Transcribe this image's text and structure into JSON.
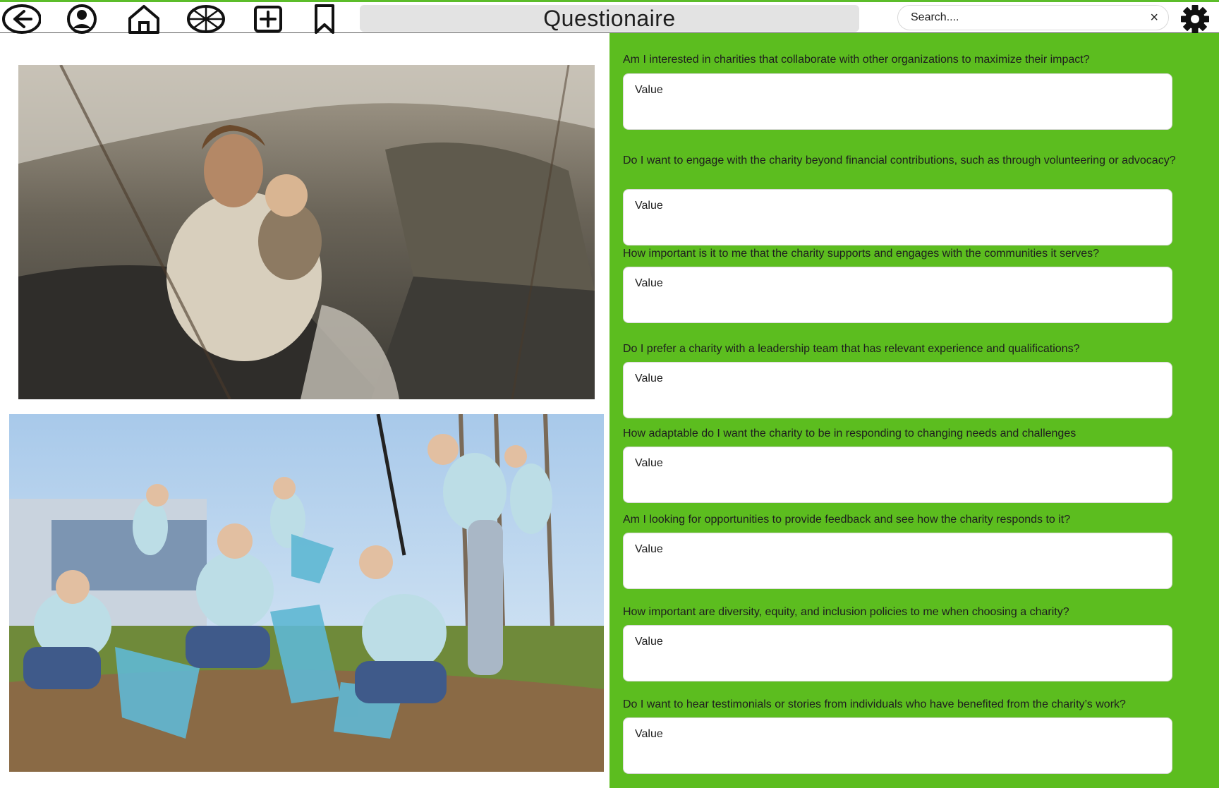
{
  "header": {
    "title": "Questionaire",
    "search": {
      "placeholder": "Search....",
      "clear_symbol": "×"
    },
    "nav_icons": [
      "back-arrow-icon",
      "profile-icon",
      "home-icon",
      "wheel-icon",
      "add-icon",
      "bookmark-icon"
    ],
    "settings_icon": "gear-icon"
  },
  "images": [
    {
      "name": "mother-and-child-photo"
    },
    {
      "name": "volunteers-cleanup-photo"
    }
  ],
  "questions": [
    {
      "label": "Am I interested in charities that collaborate with other organizations to maximize their impact?",
      "placeholder": "Value"
    },
    {
      "label": "Do I want to engage with the charity beyond financial contributions, such as through volunteering or advocacy?",
      "placeholder": "Value"
    },
    {
      "label": "How important is it to me that the charity supports and engages with the communities it serves?",
      "placeholder": "Value"
    },
    {
      "label": "Do I prefer a charity with a leadership team that has relevant experience and qualifications?",
      "placeholder": "Value"
    },
    {
      "label": "How adaptable do I want the charity to be in responding to changing needs and challenges",
      "placeholder": "Value"
    },
    {
      "label": "Am I looking for opportunities to provide feedback and see how the charity responds to it?",
      "placeholder": "Value"
    },
    {
      "label": "How important are diversity, equity, and inclusion policies to me when choosing a charity?",
      "placeholder": "Value"
    },
    {
      "label": "Do I want to hear testimonials or stories from individuals who have benefited from the charity’s work?",
      "placeholder": "Value"
    }
  ],
  "colors": {
    "panel": "#5cbd1f",
    "accent": "#5cbd2a",
    "title_bg": "#e3e3e3"
  }
}
